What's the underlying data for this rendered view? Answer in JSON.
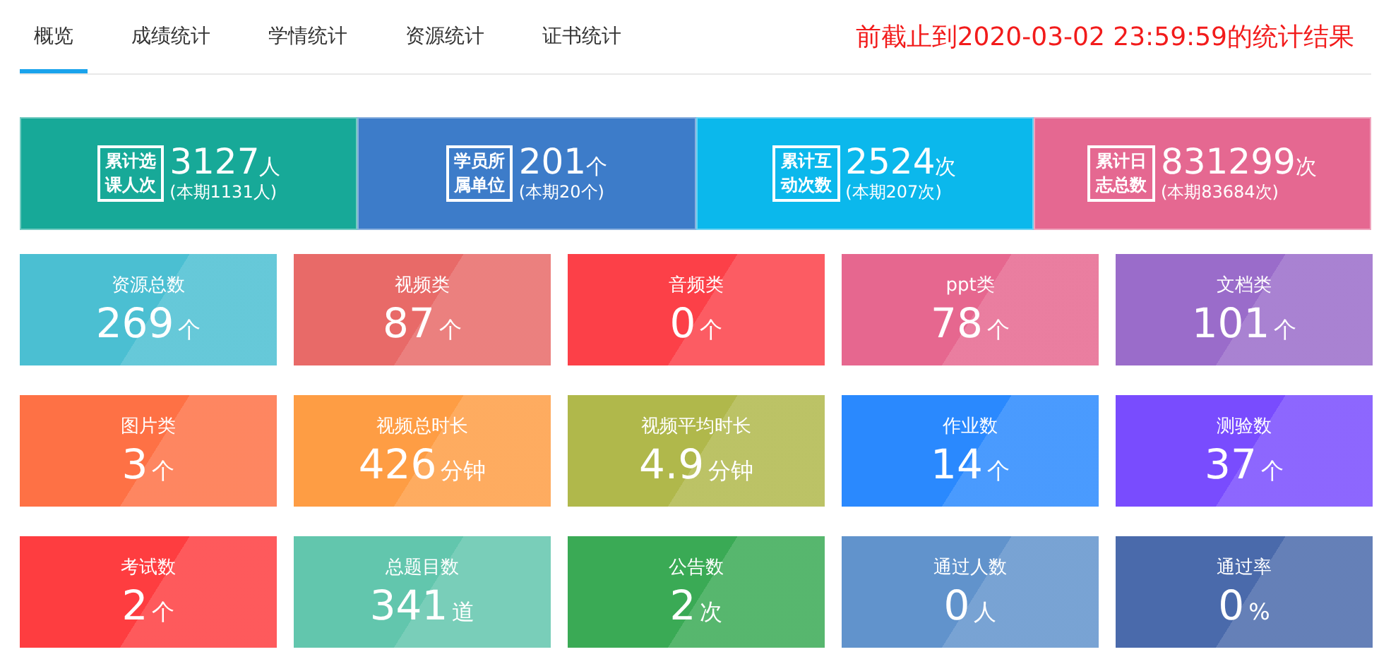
{
  "tabs": [
    {
      "label": "概览",
      "selected": true
    },
    {
      "label": "成绩统计",
      "selected": false
    },
    {
      "label": "学情统计",
      "selected": false
    },
    {
      "label": "资源统计",
      "selected": false
    },
    {
      "label": "证书统计",
      "selected": false
    }
  ],
  "headline": "前截止到2020-03-02 23:59:59的统计结果",
  "summary": [
    {
      "label": "累计选课人次",
      "value": "3127",
      "unit": "人",
      "period": "(本期1131人)",
      "color": "#17a998"
    },
    {
      "label": "学员所属单位",
      "value": "201",
      "unit": "个",
      "period": "(本期20个)",
      "color": "#3d7cc9"
    },
    {
      "label": "累计互动次数",
      "value": "2524",
      "unit": "次",
      "period": "(本期207次)",
      "color": "#0bb8ec"
    },
    {
      "label": "累计日志总数",
      "value": "831299",
      "unit": "次",
      "period": "(本期83684次)",
      "color": "#e56891"
    }
  ],
  "cards": [
    {
      "label": "资源总数",
      "value": "269",
      "unit": "个",
      "color": "#4bbfd2"
    },
    {
      "label": "视频类",
      "value": "87",
      "unit": "个",
      "color": "#e86a68"
    },
    {
      "label": "音频类",
      "value": "0",
      "unit": "个",
      "color": "#fc4048"
    },
    {
      "label": "ppt类",
      "value": "78",
      "unit": "个",
      "color": "#e6678f"
    },
    {
      "label": "文档类",
      "value": "101",
      "unit": "个",
      "color": "#9a6cca"
    },
    {
      "label": "图片类",
      "value": "3",
      "unit": "个",
      "color": "#fe7145"
    },
    {
      "label": "视频总时长",
      "value": "426",
      "unit": "分钟",
      "color": "#fe9d44"
    },
    {
      "label": "视频平均时长",
      "value": "4.9",
      "unit": "分钟",
      "color": "#b0b84b"
    },
    {
      "label": "作业数",
      "value": "14",
      "unit": "个",
      "color": "#2a89fe"
    },
    {
      "label": "测验数",
      "value": "37",
      "unit": "个",
      "color": "#794cfe"
    },
    {
      "label": "考试数",
      "value": "2",
      "unit": "个",
      "color": "#fe3d40"
    },
    {
      "label": "总题目数",
      "value": "341",
      "unit": "道",
      "color": "#62c6ad"
    },
    {
      "label": "公告数",
      "value": "2",
      "unit": "次",
      "color": "#3aaa55"
    },
    {
      "label": "通过人数",
      "value": "0",
      "unit": "人",
      "color": "#6193cc"
    },
    {
      "label": "通过率",
      "value": "0",
      "unit": "%",
      "color": "#4a6aab"
    }
  ]
}
